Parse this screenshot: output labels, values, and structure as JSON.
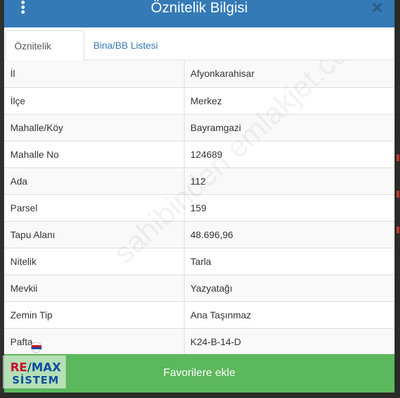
{
  "modal": {
    "title": "Öznitelik Bilgisi",
    "close_glyph": "✕"
  },
  "tabs": [
    {
      "label": "Öznitelik Bilgisi",
      "active": true
    },
    {
      "label": "Bina/BB Listesi",
      "active": false
    }
  ],
  "rows": [
    {
      "key": "İl",
      "value": "Afyonkarahisar"
    },
    {
      "key": "İlçe",
      "value": "Merkez"
    },
    {
      "key": "Mahalle/Köy",
      "value": "Bayramgazi"
    },
    {
      "key": "Mahalle No",
      "value": "124689"
    },
    {
      "key": "Ada",
      "value": "112"
    },
    {
      "key": "Parsel",
      "value": "159"
    },
    {
      "key": "Tapu Alanı",
      "value": "48.696,96"
    },
    {
      "key": "Nitelik",
      "value": "Tarla"
    },
    {
      "key": "Mevkii",
      "value": "Yazyatağı"
    },
    {
      "key": "Zemin Tip",
      "value": "Ana Taşınmaz"
    },
    {
      "key": "Pafta",
      "value": "K24-B-14-D"
    }
  ],
  "footer": {
    "favorite_label": "Favorilere ekle"
  },
  "watermark": "sahibinden emlakjet.com",
  "logo": {
    "re": "RE",
    "slash": "/",
    "max": "MAX",
    "sistem": "SİSTEM"
  },
  "colors": {
    "header": "#337ab7",
    "footer": "#5cb85c",
    "tab_link": "#337ab7",
    "logo_blue": "#0b4e9c",
    "logo_red": "#c8102e"
  },
  "icons": {
    "menu": "kebab-menu-icon",
    "close": "close-icon",
    "logo_balloon": "balloon-icon"
  }
}
